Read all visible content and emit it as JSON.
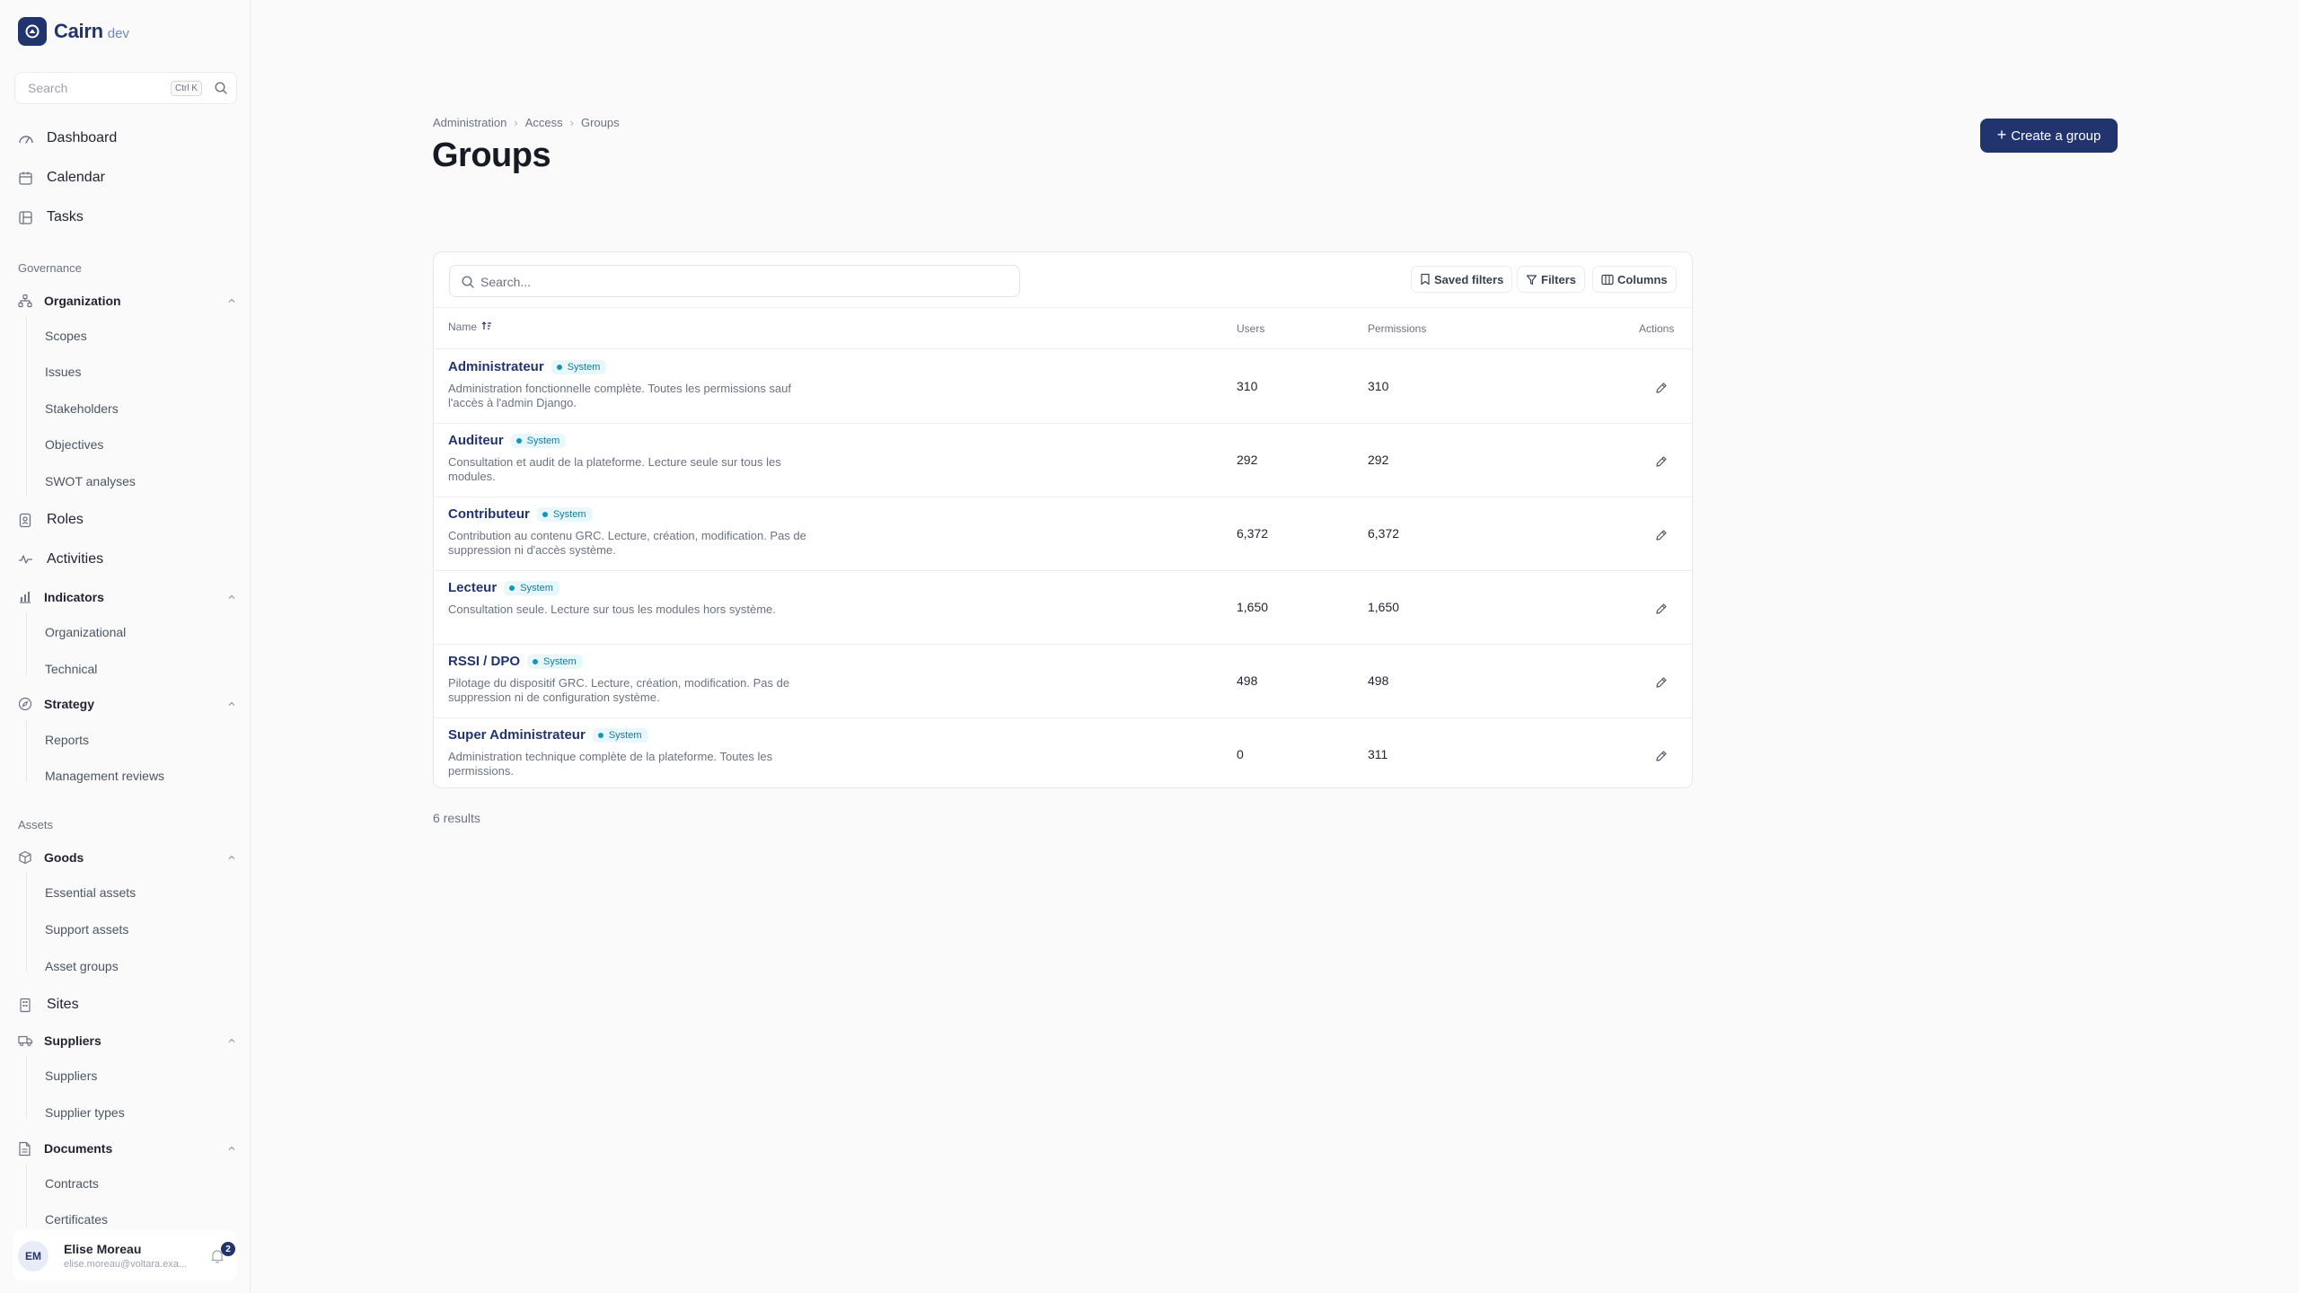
{
  "brand": {
    "name": "Cairn",
    "env": "dev"
  },
  "sidebar": {
    "search_placeholder": "Search",
    "shortcut": "Ctrl K",
    "top": [
      {
        "label": "Dashboard",
        "icon": "dashboard-icon"
      },
      {
        "label": "Calendar",
        "icon": "calendar-icon"
      },
      {
        "label": "Tasks",
        "icon": "tasks-icon"
      }
    ],
    "governance": {
      "title": "Governance",
      "organization": {
        "label": "Organization",
        "items": [
          "Scopes",
          "Issues",
          "Stakeholders",
          "Objectives",
          "SWOT analyses"
        ]
      },
      "roles": "Roles",
      "activities": "Activities",
      "indicators": {
        "label": "Indicators",
        "items": [
          "Organizational",
          "Technical"
        ]
      },
      "strategy": {
        "label": "Strategy",
        "items": [
          "Reports",
          "Management reviews"
        ]
      }
    },
    "assets": {
      "title": "Assets",
      "goods": {
        "label": "Goods",
        "items": [
          "Essential assets",
          "Support assets",
          "Asset groups"
        ]
      },
      "sites": "Sites",
      "suppliers": {
        "label": "Suppliers",
        "items": [
          "Suppliers",
          "Supplier types"
        ]
      },
      "documents": {
        "label": "Documents",
        "items": [
          "Contracts",
          "Certificates"
        ]
      }
    },
    "user": {
      "initials": "EM",
      "name": "Elise Moreau",
      "email": "elise.moreau@voltara.exa...",
      "notifications": "2"
    }
  },
  "breadcrumb": [
    "Administration",
    "Access",
    "Groups"
  ],
  "page_title": "Groups",
  "create_button": "Create a group",
  "toolbar": {
    "search_placeholder": "Search...",
    "saved_filters": "Saved filters",
    "filters": "Filters",
    "columns": "Columns"
  },
  "table": {
    "headers": {
      "name": "Name",
      "users": "Users",
      "permissions": "Permissions",
      "actions": "Actions"
    },
    "badge": "System",
    "rows": [
      {
        "name": "Administrateur",
        "desc": "Administration fonctionnelle complète. Toutes les permissions sauf l'accès à l'admin Django.",
        "users": "310",
        "permissions": "310"
      },
      {
        "name": "Auditeur",
        "desc": "Consultation et audit de la plateforme. Lecture seule sur tous les modules.",
        "users": "292",
        "permissions": "292"
      },
      {
        "name": "Contributeur",
        "desc": "Contribution au contenu GRC. Lecture, création, modification. Pas de suppression ni d'accès système.",
        "users": "6,372",
        "permissions": "6,372"
      },
      {
        "name": "Lecteur",
        "desc": "Consultation seule. Lecture sur tous les modules hors système.",
        "users": "1,650",
        "permissions": "1,650"
      },
      {
        "name": "RSSI / DPO",
        "desc": "Pilotage du dispositif GRC. Lecture, création, modification. Pas de suppression ni de configuration système.",
        "users": "498",
        "permissions": "498"
      },
      {
        "name": "Super Administrateur",
        "desc": "Administration technique complète de la plateforme. Toutes les permissions.",
        "users": "0",
        "permissions": "311"
      }
    ]
  },
  "results": "6 results",
  "colors": {
    "primary": "#22346e",
    "badge_bg": "#e8f7fa",
    "badge_text": "#127b9a",
    "badge_dot": "#1596b8"
  }
}
